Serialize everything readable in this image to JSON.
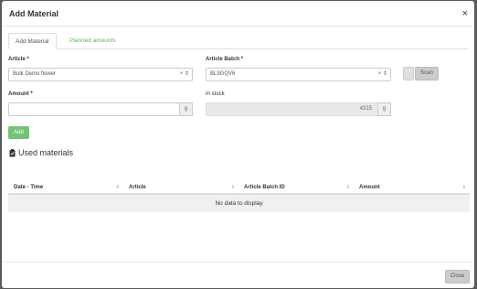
{
  "modal": {
    "title": "Add Material",
    "close_glyph": "×"
  },
  "tabs": [
    {
      "label": "Add Material",
      "active": true
    },
    {
      "label": "Planned amounts",
      "active": false
    }
  ],
  "form": {
    "article": {
      "label": "Article",
      "required_mark": "*",
      "value": "Bulk Demo flower",
      "controls": "× ⇕"
    },
    "article_batch": {
      "label": "Article Batch",
      "required_mark": "*",
      "value": "BL9GQV6",
      "controls": "× ⇕"
    },
    "scan_label": "Scan",
    "amount": {
      "label": "Amount",
      "required_mark": "*",
      "value": "",
      "unit": "g"
    },
    "in_stock": {
      "label": "In stock",
      "value": "4315",
      "unit": "g"
    },
    "add_label": "Add"
  },
  "used_materials": {
    "title": "Used materials",
    "icon": "clipboard-check-icon",
    "columns": [
      "Date - Time",
      "Article",
      "Article Batch ID",
      "Amount"
    ],
    "sort_glyph": "⇕",
    "empty_text": "No data to display"
  },
  "footer": {
    "close_label": "Close"
  },
  "colors": {
    "accent": "#5cb85c",
    "header_bg": "#ffffff",
    "empty_row_bg": "#f0f0f0"
  }
}
